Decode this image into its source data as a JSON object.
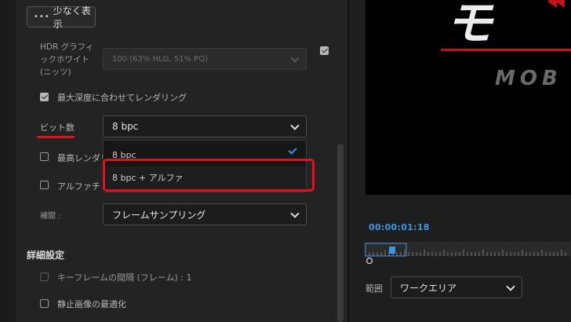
{
  "settings": {
    "show_less_label": "少なく表示",
    "hdr_label": "HDR グラフィックホワイト (ニッツ)",
    "hdr_value": "100 (63% HLG, 51% PQ)",
    "max_depth_label": "最大深度に合わせてレンダリング",
    "bit_depth_label": "ビット数",
    "bit_depth_value": "8 bpc",
    "max_render_label": "最高レンダリ",
    "alpha_label": "アルファチ",
    "interp_label": "補間 :",
    "interp_value": "フレームサンプリング",
    "advanced_heading": "詳細設定",
    "keyframe_label": "キーフレームの間隔 (フレーム) : 1",
    "still_label": "静止画像の最適化"
  },
  "dropdown": {
    "options": [
      "8 bpc",
      "8 bpc + アルファ"
    ],
    "selected_index": 0,
    "highlighted_index": 1
  },
  "preview": {
    "logo_text": "モ",
    "logo_subtext": "MOB"
  },
  "timeline": {
    "timecode": "00:00:01:18",
    "range_label": "範囲",
    "range_value": "ワークエリア"
  },
  "colors": {
    "accent_blue": "#3d8ee8",
    "highlight_red": "#e0121f"
  }
}
